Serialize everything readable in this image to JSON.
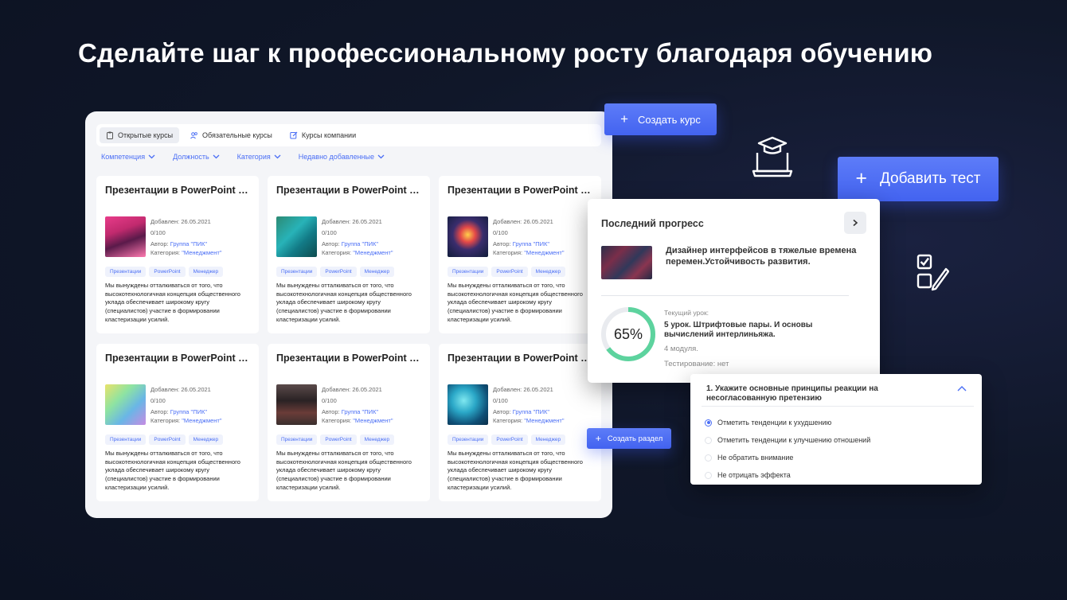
{
  "headline": "Сделайте шаг к профессиональному росту благодаря обучению",
  "tabs": [
    {
      "label": "Открытые курсы",
      "icon": "clipboard-icon",
      "active": true
    },
    {
      "label": "Обязательные курсы",
      "icon": "users-icon",
      "active": false
    },
    {
      "label": "Курсы компании",
      "icon": "edit-icon",
      "active": false
    }
  ],
  "filters": [
    "Компетенция",
    "Должность",
    "Категория",
    "Недавно добавленные"
  ],
  "cards": [
    {
      "title": "Презентации в PowerPoint и...",
      "added_label": "Добавлен:",
      "added": "26.05.2021",
      "progress": "0/100",
      "author_label": "Автор:",
      "author": "Группа \"ПИК\"",
      "category_label": "Категория:",
      "category": "\"Менеджмент\"",
      "tags": [
        "Презентации",
        "PowerPoint",
        "Менеджер"
      ],
      "description": "Мы вынуждены отталкиваться от того, что высокотехнологичная концепция общественного уклада обеспечивает широкому кругу (специалистов) участие в формировании кластеризации усилий."
    },
    {
      "title": "Презентации в PowerPoint и...",
      "added_label": "Добавлен:",
      "added": "26.05.2021",
      "progress": "0/100",
      "author_label": "Автор:",
      "author": "Группа \"ПИК\"",
      "category_label": "Категория:",
      "category": "\"Менеджмент\"",
      "tags": [
        "Презентации",
        "PowerPoint",
        "Менеджер"
      ],
      "description": "Мы вынуждены отталкиваться от того, что высокотехнологичная концепция общественного уклада обеспечивает широкому кругу (специалистов) участие в формировании кластеризации усилий."
    },
    {
      "title": "Презентации в PowerPoint и...",
      "added_label": "Добавлен:",
      "added": "26.05.2021",
      "progress": "0/100",
      "author_label": "Автор:",
      "author": "Группа \"ПИК\"",
      "category_label": "Категория:",
      "category": "\"Менеджмент\"",
      "tags": [
        "Презентации",
        "PowerPoint",
        "Менеджер"
      ],
      "description": "Мы вынуждены отталкиваться от того, что высокотехнологичная концепция общественного уклада обеспечивает широкому кругу (специалистов) участие в формировании кластеризации усилий."
    },
    {
      "title": "Презентации в PowerPoint и...",
      "added_label": "Добавлен:",
      "added": "26.05.2021",
      "progress": "0/100",
      "author_label": "Автор:",
      "author": "Группа \"ПИК\"",
      "category_label": "Категория:",
      "category": "\"Менеджмент\"",
      "tags": [
        "Презентации",
        "PowerPoint",
        "Менеджер"
      ],
      "description": "Мы вынуждены отталкиваться от того, что высокотехнологичная концепция общественного уклада обеспечивает широкому кругу (специалистов) участие в формировании кластеризации усилий."
    },
    {
      "title": "Презентации в PowerPoint и...",
      "added_label": "Добавлен:",
      "added": "26.05.2021",
      "progress": "0/100",
      "author_label": "Автор:",
      "author": "Группа \"ПИК\"",
      "category_label": "Категория:",
      "category": "\"Менеджмент\"",
      "tags": [
        "Презентации",
        "PowerPoint",
        "Менеджер"
      ],
      "description": "Мы вынуждены отталкиваться от того, что высокотехнологичная концепция общественного уклада обеспечивает широкому кругу (специалистов) участие в формировании кластеризации усилий."
    },
    {
      "title": "Презентации в PowerPoint и...",
      "added_label": "Добавлен:",
      "added": "26.05.2021",
      "progress": "0/100",
      "author_label": "Автор:",
      "author": "Группа \"ПИК\"",
      "category_label": "Категория:",
      "category": "\"Менеджмент\"",
      "tags": [
        "Презентации",
        "PowerPoint",
        "Менеджер"
      ],
      "description": "Мы вынуждены отталкиваться от того, что высокотехнологичная концепция общественного уклада обеспечивает широкому кругу (специалистов) участие в формировании кластеризации усилий."
    }
  ],
  "buttons": {
    "create_course": "Создать курс",
    "add_test": "Добавить тест",
    "create_section": "Создать раздел",
    "plus": "+"
  },
  "progress_card": {
    "title": "Последний прогресс",
    "course_title": "Дизайнер интерфейсов в тяжелые времена перемен.Устойчивость развития.",
    "percent": 65,
    "percent_label": "65%",
    "current_lesson_label": "Текущий урок:",
    "current_lesson": "5 урок. Штрифтовые пары. И основы вычислений интерлиньяжа.",
    "modules": "4 модуля.",
    "testing": "Тестирование: нет"
  },
  "quiz": {
    "question": "1. Укажите основные принципы реакции на несогласованную претензию",
    "options": [
      {
        "label": "Отметить тенденции к ухудшению",
        "selected": true
      },
      {
        "label": "Отметить тенденции к улучшению отношений",
        "selected": false
      },
      {
        "label": "Не обратить внимание",
        "selected": false
      },
      {
        "label": "Не отрицать эффекта",
        "selected": false
      }
    ]
  },
  "colors": {
    "accent": "#4a6ef5",
    "progress_ring": "#5dd39e",
    "background": "#101729"
  }
}
